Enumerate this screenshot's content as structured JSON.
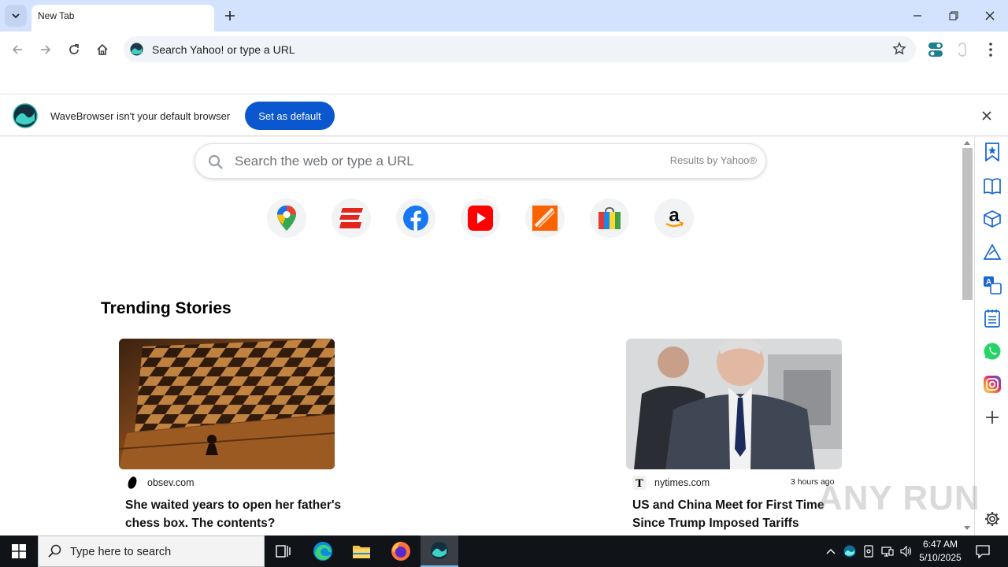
{
  "browser": {
    "tab_title": "New Tab",
    "omnibox_text": "Search Yahoo! or type a URL"
  },
  "infobar": {
    "message": "WaveBrowser isn't your default browser",
    "button_label": "Set as default"
  },
  "search": {
    "placeholder": "Search the web or type a URL",
    "provider_note": "Results by Yahoo®"
  },
  "shortcuts": [
    {
      "name": "google-maps-shortcut",
      "icon": "map-pin-icon"
    },
    {
      "name": "espn-shortcut",
      "icon": "espn-logo-icon"
    },
    {
      "name": "facebook-shortcut",
      "icon": "facebook-icon"
    },
    {
      "name": "youtube-shortcut",
      "icon": "youtube-icon"
    },
    {
      "name": "home-depot-shortcut",
      "icon": "home-depot-icon"
    },
    {
      "name": "shopping-shortcut",
      "icon": "shopping-bag-icon"
    },
    {
      "name": "amazon-shortcut",
      "icon": "amazon-icon"
    }
  ],
  "trending": {
    "title": "Trending Stories",
    "stories": [
      {
        "source": "obsev.com",
        "time": "",
        "headline": "She waited years to open her father's chess box. The contents?"
      },
      {
        "source": "nytimes.com",
        "time": "3 hours ago",
        "headline": "US and China Meet for First Time Since Trump Imposed Tariffs"
      }
    ]
  },
  "watermark": "ANY RUN",
  "taskbar": {
    "search_placeholder": "Type here to search",
    "time": "6:47 AM",
    "date": "5/10/2025"
  },
  "colors": {
    "tabstrip_bg": "#d3e3fd",
    "accent_button": "#0b57d0",
    "taskbar_bg": "#101318"
  }
}
